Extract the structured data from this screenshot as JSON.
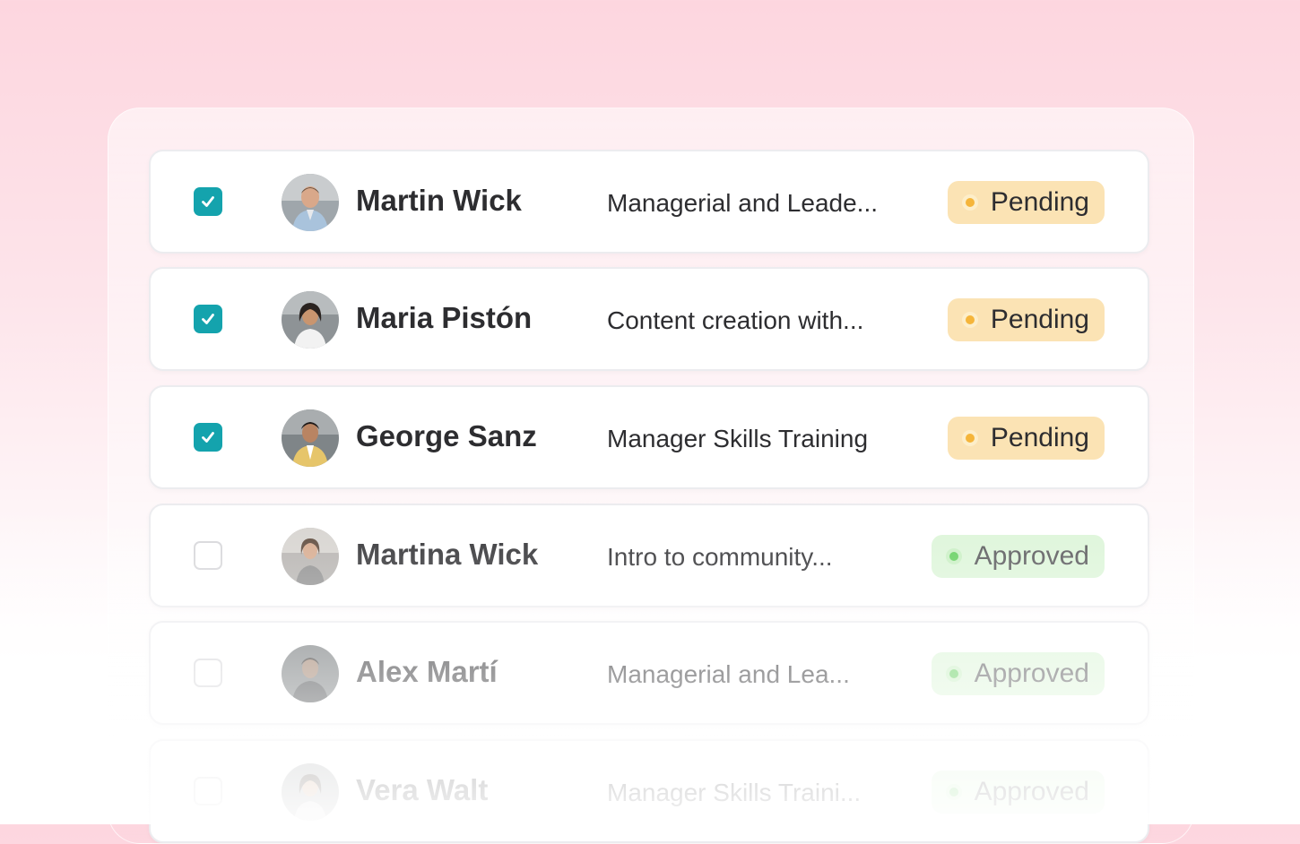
{
  "colors": {
    "checkbox_checked": "#14a3ad",
    "pending_badge": "#fbe3b4",
    "pending_dot": "#f5b53a",
    "approved_badge": "#dcf5d8",
    "approved_dot": "#5fce5a"
  },
  "rows": [
    {
      "checked": true,
      "name": "Martin Wick",
      "course": "Managerial and Leade...",
      "status": "Pending",
      "status_type": "pending"
    },
    {
      "checked": true,
      "name": "Maria Pistón",
      "course": "Content creation with...",
      "status": "Pending",
      "status_type": "pending"
    },
    {
      "checked": true,
      "name": "George Sanz",
      "course": "Manager Skills Training",
      "status": "Pending",
      "status_type": "pending"
    },
    {
      "checked": false,
      "name": "Martina Wick",
      "course": "Intro to community...",
      "status": "Approved",
      "status_type": "approved"
    },
    {
      "checked": false,
      "name": "Alex Martí",
      "course": "Managerial and Lea...",
      "status": "Approved",
      "status_type": "approved"
    },
    {
      "checked": false,
      "name": "Vera Walt",
      "course": "Manager Skills Traini...",
      "status": "Approved",
      "status_type": "approved"
    }
  ]
}
